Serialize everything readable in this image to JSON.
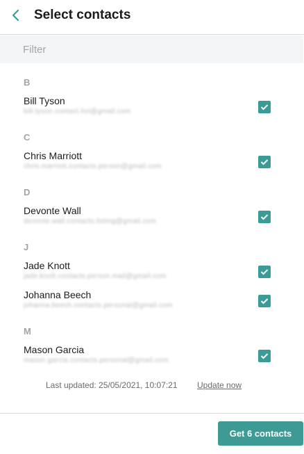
{
  "header": {
    "title": "Select contacts",
    "back_icon": "chevron-left-icon"
  },
  "filter": {
    "placeholder": "Filter",
    "value": ""
  },
  "sections": [
    {
      "letter": "B",
      "contacts": [
        {
          "name": "Bill Tyson",
          "email": "bill.tyson.contact.list@gmail.com",
          "checked": true
        }
      ]
    },
    {
      "letter": "C",
      "contacts": [
        {
          "name": "Chris Marriott",
          "email": "chris.marriott.contacts.person@gmail.com",
          "checked": true
        }
      ]
    },
    {
      "letter": "D",
      "contacts": [
        {
          "name": "Devonte Wall",
          "email": "devonte.wall.contacts.listing@gmail.com",
          "checked": true
        }
      ]
    },
    {
      "letter": "J",
      "contacts": [
        {
          "name": "Jade Knott",
          "email": "jade.knott.contacts.person.mail@gmail.com",
          "checked": true
        },
        {
          "name": "Johanna Beech",
          "email": "johanna.beech.contacts.personal@gmail.com",
          "checked": true
        }
      ]
    },
    {
      "letter": "M",
      "contacts": [
        {
          "name": "Mason Garcia",
          "email": "mason.garcia.contacts.personal@gmail.com",
          "checked": true
        }
      ]
    }
  ],
  "footer": {
    "last_updated": "Last updated: 25/05/2021, 10:07:21",
    "update_now": "Update now",
    "get_button": "Get 6 contacts"
  },
  "colors": {
    "accent": "#3e9a95",
    "back_icon": "#3b9b97"
  }
}
